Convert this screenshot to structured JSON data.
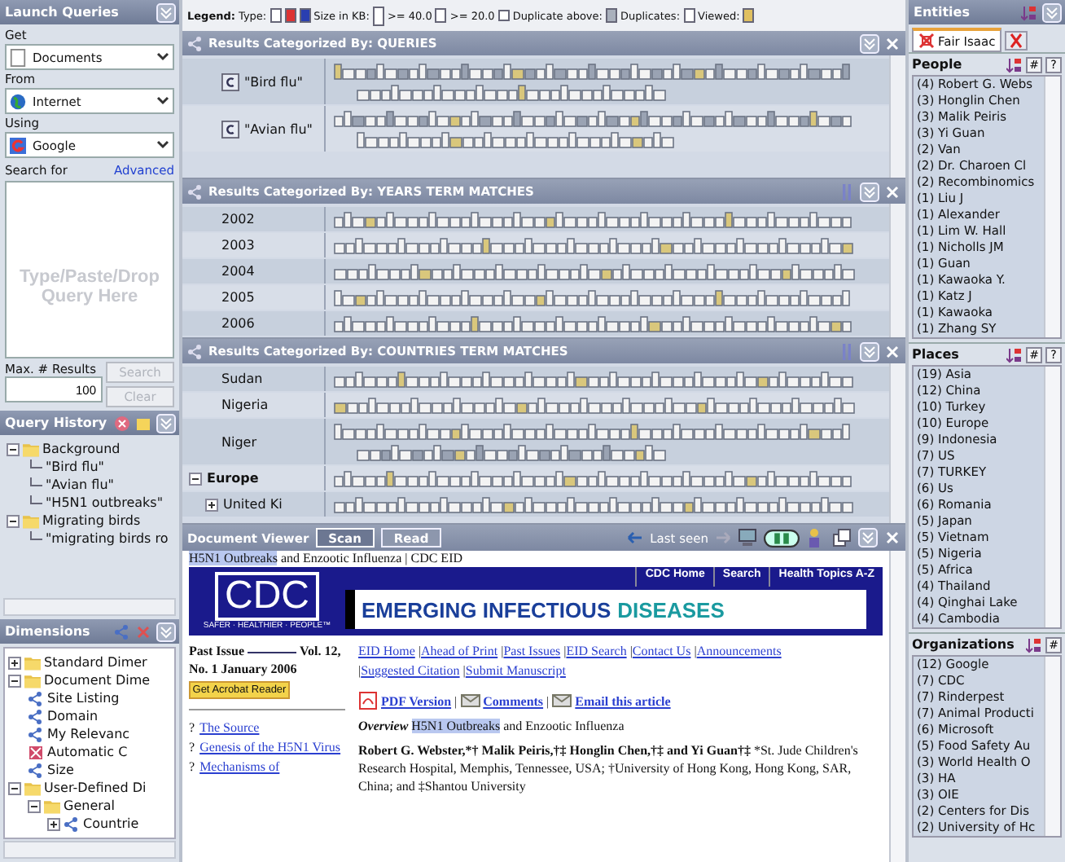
{
  "launch_queries": {
    "title": "Launch Queries",
    "get_label": "Get",
    "get_value": "Documents",
    "from_label": "From",
    "from_value": "Internet",
    "using_label": "Using",
    "using_value": "Google",
    "search_for_label": "Search for",
    "advanced_link": "Advanced",
    "query_placeholder": "Type/Paste/Drop Query Here",
    "max_results_label": "Max. # Results",
    "max_results_value": "100",
    "search_button": {
      "label": "Search",
      "disabled": true
    },
    "clear_button": {
      "label": "Clear",
      "disabled": true
    }
  },
  "query_history": {
    "title": "Query History",
    "tree": [
      {
        "label": "Background",
        "kind": "folder",
        "expanded": true,
        "children": [
          {
            "label": "\"Bird flu\"",
            "kind": "query"
          },
          {
            "label": "\"Avian flu\"",
            "kind": "query"
          },
          {
            "label": "\"H5N1 outbreaks\"",
            "kind": "query"
          }
        ]
      },
      {
        "label": "Migrating birds",
        "kind": "folder",
        "expanded": true,
        "children": [
          {
            "label": "\"migrating birds ro",
            "kind": "query"
          }
        ]
      }
    ]
  },
  "dimensions": {
    "title": "Dimensions",
    "tree": [
      {
        "label": "Standard Dimer",
        "kind": "folder",
        "expanded": false
      },
      {
        "label": "Document Dime",
        "kind": "folder",
        "expanded": true,
        "children": [
          {
            "label": "Site Listing",
            "kind": "dimension"
          },
          {
            "label": "Domain",
            "kind": "dimension"
          },
          {
            "label": "My Relevanc",
            "kind": "dimension"
          },
          {
            "label": "Automatic C",
            "kind": "automatic"
          },
          {
            "label": "Size",
            "kind": "dimension"
          }
        ]
      },
      {
        "label": "User-Defined Di",
        "kind": "folder",
        "expanded": true,
        "children": [
          {
            "label": "General",
            "kind": "folder",
            "expanded": true,
            "children": [
              {
                "label": "Countrie",
                "kind": "dimension",
                "expanded": false
              }
            ]
          }
        ]
      }
    ]
  },
  "legend": {
    "label": "Legend:",
    "type_label": "Type:",
    "size_label": "Size in KB:",
    "size_large": ">= 40.0",
    "size_medium": ">= 20.0",
    "duplicate_above_label": "Duplicate above:",
    "duplicates_label": "Duplicates:",
    "viewed_label": "Viewed:"
  },
  "result_panels": [
    {
      "title": "Results Categorized By:  QUERIES",
      "rows": [
        {
          "label": "\"Bird flu\"",
          "kind": "item",
          "wrapped": true
        },
        {
          "label": "\"Avian flu\"",
          "kind": "item",
          "wrapped": true
        }
      ]
    },
    {
      "title": "Results Categorized By:  YEARS TERM MATCHES",
      "rows": [
        {
          "label": "2002",
          "kind": "item",
          "wrapped": false
        },
        {
          "label": "2003",
          "kind": "item",
          "wrapped": false
        },
        {
          "label": "2004",
          "kind": "item",
          "wrapped": false
        },
        {
          "label": "2005",
          "kind": "item",
          "wrapped": false
        },
        {
          "label": "2006",
          "kind": "item",
          "wrapped": false
        }
      ]
    },
    {
      "title": "Results Categorized By:  COUNTRIES TERM MATCHES",
      "rows": [
        {
          "label": "Sudan",
          "kind": "item",
          "wrapped": false
        },
        {
          "label": "Nigeria",
          "kind": "item",
          "wrapped": false
        },
        {
          "label": "Niger",
          "kind": "item",
          "wrapped": true
        },
        {
          "label": "Europe",
          "kind": "group",
          "expanded": true,
          "wrapped": false
        },
        {
          "label": "United Ki",
          "kind": "subgroup",
          "expanded": false,
          "wrapped": false
        }
      ]
    }
  ],
  "document_viewer": {
    "title": "Document Viewer",
    "tabs": [
      {
        "label": "Scan",
        "selected": true
      },
      {
        "label": "Read",
        "selected": false
      }
    ],
    "last_seen": "Last seen",
    "page_title": {
      "highlight": "H5N1 Outbreaks",
      "rest": " and Enzootic Influenza | CDC EID"
    },
    "banner": {
      "logo": "CDC",
      "tagline": "SAFER · HEALTHIER · PEOPLE™",
      "nav": [
        "CDC Home",
        "Search",
        "Health Topics A-Z"
      ],
      "journal_word_1": "EMERGING INFECTIOUS",
      "journal_word_2": "DISEASES"
    },
    "past_issue": "Past Issue",
    "volume": "Vol. 12, No. 1 January 2006",
    "acrobat": "Get Acrobat Reader",
    "toc": [
      {
        "bullet": "?",
        "text": "The Source"
      },
      {
        "bullet": "?",
        "text": "Genesis of the H5N1 Virus"
      },
      {
        "bullet": "?",
        "text": "Mechanisms of"
      }
    ],
    "link_separator": "|",
    "nav_links": [
      "EID Home",
      "Ahead of Print",
      "Past Issues",
      "EID Search",
      "Contact Us",
      "Announcements",
      "Suggested Citation",
      "Submit Manuscript"
    ],
    "actions": [
      "PDF Version",
      "Comments",
      "Email this article"
    ],
    "overview": {
      "label": "Overview",
      "highlight": "H5N1 Outbreaks",
      "rest": "and Enzootic Influenza"
    },
    "authors": "Robert G. Webster,*† Malik Peiris,†‡ Honglin Chen,†‡ and Yi Guan†‡",
    "affiliation": "*St. Jude Children's Research Hospital, Memphis, Tennessee, USA; †University of Hong Kong, Hong Kong, SAR, China; and ‡Shantou University"
  },
  "entities": {
    "title": "Entities",
    "tab": "Fair Isaac",
    "sections": [
      {
        "title": "People",
        "count_button": "#",
        "help_button": "?",
        "items": [
          "(4) Robert G. Webs",
          "(3) Honglin Chen",
          "(3) Malik Peiris",
          "(3) Yi Guan",
          "(2) Van",
          "(2) Dr. Charoen Cl",
          "(2) Recombinomics",
          "(1) Liu J",
          "(1) Alexander",
          "(1) Lim W. Hall",
          "(1) Nicholls JM",
          "(1) Guan",
          "(1) Kawaoka Y.",
          "(1) Katz J",
          "(1) Kawaoka",
          "(1) Zhang SY"
        ]
      },
      {
        "title": "Places",
        "count_button": "#",
        "help_button": "?",
        "items": [
          "(19) Asia",
          "(12) China",
          "(10) Turkey",
          "(10) Europe",
          "(9) Indonesia",
          "(7) US",
          "(7) TURKEY",
          "(6) Us",
          "(6) Romania",
          "(5) Japan",
          "(5) Vietnam",
          "(5) Nigeria",
          "(5) Africa",
          "(4) Thailand",
          "(4) Qinghai Lake",
          "(4) Cambodia"
        ]
      },
      {
        "title": "Organizations",
        "count_button": "#",
        "items": [
          "(12) Google",
          "(7) CDC",
          "(7) Rinderpest",
          "(7) Animal Producti",
          "(6) Microsoft",
          "(5) Food Safety Au",
          "(3) World Health O",
          "(3) HA",
          "(3) OIE",
          "(2) Centers for Dis",
          "(2) University of Hc"
        ]
      }
    ]
  }
}
